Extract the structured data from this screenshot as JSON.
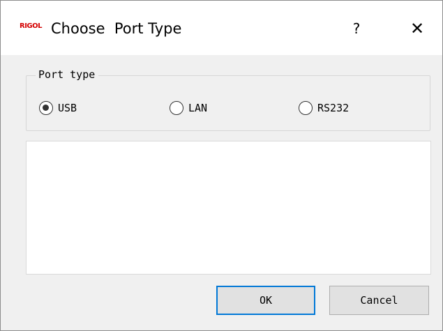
{
  "window": {
    "icon_text": "RIGOL",
    "title": "Choose  Port Type",
    "help_label": "?",
    "close_label": "✕"
  },
  "port_type": {
    "legend": "Port type",
    "options": [
      {
        "label": "USB",
        "selected": true
      },
      {
        "label": "LAN",
        "selected": false
      },
      {
        "label": "RS232",
        "selected": false
      }
    ]
  },
  "buttons": {
    "ok_label": "OK",
    "cancel_label": "Cancel"
  },
  "colors": {
    "focus_border": "#0078d7",
    "icon_red": "#d40000"
  }
}
